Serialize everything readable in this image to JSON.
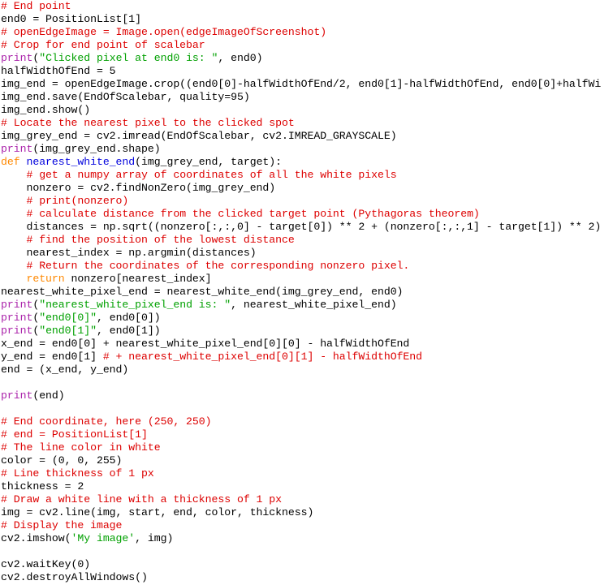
{
  "document": {
    "kind": "source-code-listing",
    "language": "Python",
    "background_color": "#ffffff",
    "colors": {
      "plain": "#000000",
      "comment": "#dd0000",
      "keyword": "#ff8800",
      "builtin": "#aa22aa",
      "function_name": "#0000dd",
      "string": "#00a000"
    }
  },
  "lines": [
    {
      "n": 1,
      "tokens": [
        {
          "t": "comment",
          "s": "# End point"
        }
      ]
    },
    {
      "n": 2,
      "tokens": [
        {
          "t": "plain",
          "s": "end0 = PositionList[1]"
        }
      ]
    },
    {
      "n": 3,
      "tokens": [
        {
          "t": "comment",
          "s": "# openEdgeImage = Image.open(edgeImageOfScreenshot)"
        }
      ]
    },
    {
      "n": 4,
      "tokens": [
        {
          "t": "comment",
          "s": "# Crop for end point of scalebar"
        }
      ]
    },
    {
      "n": 5,
      "tokens": [
        {
          "t": "builtin",
          "s": "print"
        },
        {
          "t": "plain",
          "s": "("
        },
        {
          "t": "string",
          "s": "\"Clicked pixel at end0 is: \""
        },
        {
          "t": "plain",
          "s": ", end0)"
        }
      ]
    },
    {
      "n": 6,
      "tokens": [
        {
          "t": "plain",
          "s": "halfWidthOfEnd = 5"
        }
      ]
    },
    {
      "n": 7,
      "tokens": [
        {
          "t": "plain",
          "s": "img_end = openEdgeImage.crop((end0[0]-halfWidthOfEnd/2, end0[1]-halfWidthOfEnd, end0[0]+halfWi"
        }
      ]
    },
    {
      "n": 8,
      "tokens": [
        {
          "t": "plain",
          "s": "img_end.save(EndOfScalebar, quality=95)"
        }
      ]
    },
    {
      "n": 9,
      "tokens": [
        {
          "t": "plain",
          "s": "img_end.show()"
        }
      ]
    },
    {
      "n": 10,
      "tokens": [
        {
          "t": "comment",
          "s": "# Locate the nearest pixel to the clicked spot"
        }
      ]
    },
    {
      "n": 11,
      "tokens": [
        {
          "t": "plain",
          "s": "img_grey_end = cv2.imread(EndOfScalebar, cv2.IMREAD_GRAYSCALE)"
        }
      ]
    },
    {
      "n": 12,
      "tokens": [
        {
          "t": "builtin",
          "s": "print"
        },
        {
          "t": "plain",
          "s": "(img_grey_end.shape)"
        }
      ]
    },
    {
      "n": 13,
      "tokens": [
        {
          "t": "keyword",
          "s": "def"
        },
        {
          "t": "plain",
          "s": " "
        },
        {
          "t": "func",
          "s": "nearest_white_end"
        },
        {
          "t": "plain",
          "s": "(img_grey_end, target):"
        }
      ]
    },
    {
      "n": 14,
      "tokens": [
        {
          "t": "plain",
          "s": "    "
        },
        {
          "t": "comment",
          "s": "# get a numpy array of coordinates of all the white pixels"
        }
      ]
    },
    {
      "n": 15,
      "tokens": [
        {
          "t": "plain",
          "s": "    nonzero = cv2.findNonZero(img_grey_end)"
        }
      ]
    },
    {
      "n": 16,
      "tokens": [
        {
          "t": "plain",
          "s": "    "
        },
        {
          "t": "comment",
          "s": "# print(nonzero)"
        }
      ]
    },
    {
      "n": 17,
      "tokens": [
        {
          "t": "plain",
          "s": "    "
        },
        {
          "t": "comment",
          "s": "# calculate distance from the clicked target point (Pythagoras theorem)"
        }
      ]
    },
    {
      "n": 18,
      "tokens": [
        {
          "t": "plain",
          "s": "    distances = np.sqrt((nonzero[:,:,0] - target[0]) ** 2 + (nonzero[:,:,1] - target[1]) ** 2)"
        }
      ]
    },
    {
      "n": 19,
      "tokens": [
        {
          "t": "plain",
          "s": "    "
        },
        {
          "t": "comment",
          "s": "# find the position of the lowest distance"
        }
      ]
    },
    {
      "n": 20,
      "tokens": [
        {
          "t": "plain",
          "s": "    nearest_index = np.argmin(distances)"
        }
      ]
    },
    {
      "n": 21,
      "tokens": [
        {
          "t": "plain",
          "s": "    "
        },
        {
          "t": "comment",
          "s": "# Return the coordinates of the corresponding nonzero pixel."
        }
      ]
    },
    {
      "n": 22,
      "tokens": [
        {
          "t": "plain",
          "s": "    "
        },
        {
          "t": "keyword",
          "s": "return"
        },
        {
          "t": "plain",
          "s": " nonzero[nearest_index]"
        }
      ]
    },
    {
      "n": 23,
      "tokens": [
        {
          "t": "plain",
          "s": "nearest_white_pixel_end = nearest_white_end(img_grey_end, end0)"
        }
      ]
    },
    {
      "n": 24,
      "tokens": [
        {
          "t": "builtin",
          "s": "print"
        },
        {
          "t": "plain",
          "s": "("
        },
        {
          "t": "string",
          "s": "\"nearest_white_pixel_end is: \""
        },
        {
          "t": "plain",
          "s": ", nearest_white_pixel_end)"
        }
      ]
    },
    {
      "n": 25,
      "tokens": [
        {
          "t": "builtin",
          "s": "print"
        },
        {
          "t": "plain",
          "s": "("
        },
        {
          "t": "string",
          "s": "\"end0[0]\""
        },
        {
          "t": "plain",
          "s": ", end0[0])"
        }
      ]
    },
    {
      "n": 26,
      "tokens": [
        {
          "t": "builtin",
          "s": "print"
        },
        {
          "t": "plain",
          "s": "("
        },
        {
          "t": "string",
          "s": "\"end0[1]\""
        },
        {
          "t": "plain",
          "s": ", end0[1])"
        }
      ]
    },
    {
      "n": 27,
      "tokens": [
        {
          "t": "plain",
          "s": "x_end = end0[0] + nearest_white_pixel_end[0][0] - halfWidthOfEnd"
        }
      ]
    },
    {
      "n": 28,
      "tokens": [
        {
          "t": "plain",
          "s": "y_end = end0[1] "
        },
        {
          "t": "comment",
          "s": "# + nearest_white_pixel_end[0][1] - halfWidthOfEnd"
        }
      ]
    },
    {
      "n": 29,
      "tokens": [
        {
          "t": "plain",
          "s": "end = (x_end, y_end)"
        }
      ]
    },
    {
      "n": 30,
      "tokens": []
    },
    {
      "n": 31,
      "tokens": [
        {
          "t": "builtin",
          "s": "print"
        },
        {
          "t": "plain",
          "s": "(end)"
        }
      ]
    },
    {
      "n": 32,
      "tokens": []
    },
    {
      "n": 33,
      "tokens": [
        {
          "t": "comment",
          "s": "# End coordinate, here (250, 250)"
        }
      ]
    },
    {
      "n": 34,
      "tokens": [
        {
          "t": "comment",
          "s": "# end = PositionList[1]"
        }
      ]
    },
    {
      "n": 35,
      "tokens": [
        {
          "t": "comment",
          "s": "# The line color in white"
        }
      ]
    },
    {
      "n": 36,
      "tokens": [
        {
          "t": "plain",
          "s": "color = (0, 0, 255)"
        }
      ]
    },
    {
      "n": 37,
      "tokens": [
        {
          "t": "comment",
          "s": "# Line thickness of 1 px"
        }
      ]
    },
    {
      "n": 38,
      "tokens": [
        {
          "t": "plain",
          "s": "thickness = 2"
        }
      ]
    },
    {
      "n": 39,
      "tokens": [
        {
          "t": "comment",
          "s": "# Draw a white line with a thickness of 1 px"
        }
      ]
    },
    {
      "n": 40,
      "tokens": [
        {
          "t": "plain",
          "s": "img = cv2.line(img, start, end, color, thickness)"
        }
      ]
    },
    {
      "n": 41,
      "tokens": [
        {
          "t": "comment",
          "s": "# Display the image"
        }
      ]
    },
    {
      "n": 42,
      "tokens": [
        {
          "t": "plain",
          "s": "cv2.imshow("
        },
        {
          "t": "string",
          "s": "'My image'"
        },
        {
          "t": "plain",
          "s": ", img)"
        }
      ]
    },
    {
      "n": 43,
      "tokens": []
    },
    {
      "n": 44,
      "tokens": [
        {
          "t": "plain",
          "s": "cv2.waitKey(0)"
        }
      ]
    },
    {
      "n": 45,
      "tokens": [
        {
          "t": "plain",
          "s": "cv2.destroyAllWindows()"
        }
      ]
    }
  ]
}
